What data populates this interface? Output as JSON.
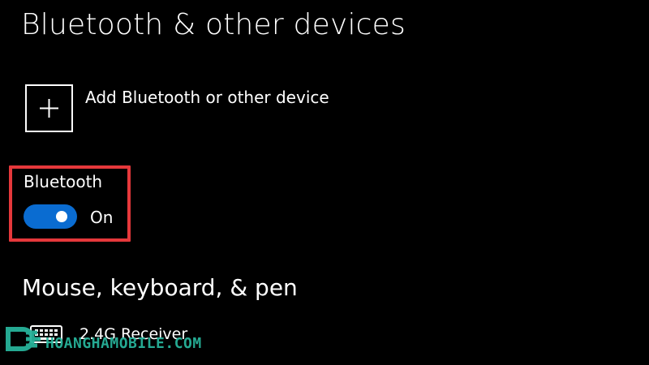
{
  "page": {
    "title": "Bluetooth & other devices"
  },
  "add_device": {
    "label": "Add Bluetooth or other device",
    "icon": "plus-icon"
  },
  "bluetooth": {
    "label": "Bluetooth",
    "toggle_state": "On",
    "enabled": true,
    "toggle_color": "#0a6cd1",
    "highlight_color": "#e5383b"
  },
  "section": {
    "title": "Mouse, keyboard, & pen"
  },
  "devices": [
    {
      "name": "2.4G Receiver",
      "icon": "keyboard-icon"
    }
  ],
  "watermark": {
    "text": "HOANGHAMOBILE.COM",
    "color": "#27b39a"
  }
}
